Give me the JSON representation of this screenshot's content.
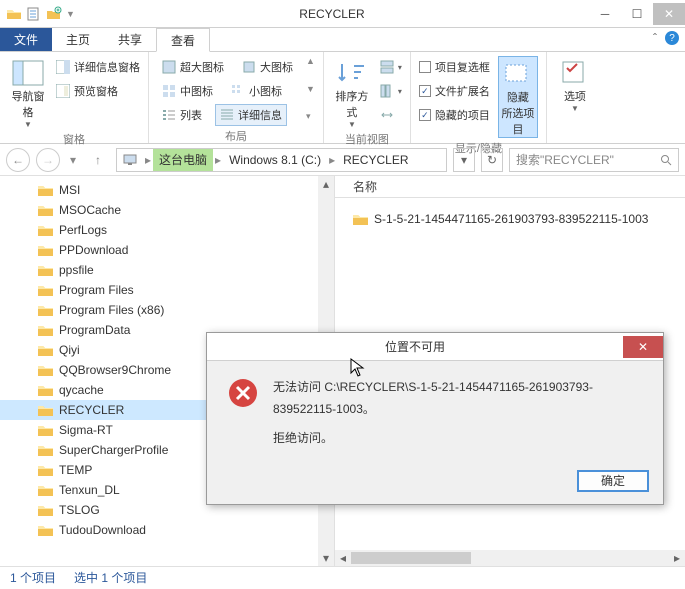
{
  "window": {
    "title": "RECYCLER"
  },
  "ribbon": {
    "tabs": {
      "file": "文件",
      "home": "主页",
      "share": "共享",
      "view": "查看"
    },
    "groups": {
      "panes": {
        "label": "窗格",
        "nav_pane": "导航窗格",
        "preview_pane": "预览窗格",
        "details_pane": "详细信息窗格"
      },
      "layout": {
        "label": "布局",
        "extra_large": "超大图标",
        "large": "大图标",
        "medium": "中图标",
        "small": "小图标",
        "list": "列表",
        "details": "详细信息"
      },
      "current_view": {
        "label": "当前视图",
        "sort": "排序方式"
      },
      "show_hide": {
        "label": "显示/隐藏",
        "item_checkboxes": "项目复选框",
        "file_ext": "文件扩展名",
        "hidden_items": "隐藏的项目",
        "hide": "隐藏",
        "selected": "所选项目"
      },
      "options": {
        "label": "选项"
      }
    }
  },
  "nav": {
    "crumb1": "这台电脑",
    "crumb2": "Windows 8.1 (C:)",
    "crumb3": "RECYCLER",
    "search_placeholder": "搜索\"RECYCLER\""
  },
  "tree": {
    "items": [
      "MSI",
      "MSOCache",
      "PerfLogs",
      "PPDownload",
      "ppsfile",
      "Program Files",
      "Program Files (x86)",
      "ProgramData",
      "Qiyi",
      "QQBrowser9Chrome",
      "qycache",
      "RECYCLER",
      "Sigma-RT",
      "SuperChargerProfile",
      "TEMP",
      "Tenxun_DL",
      "TSLOG",
      "TudouDownload"
    ],
    "selected_index": 11
  },
  "files": {
    "header_name": "名称",
    "item0": "S-1-5-21-1454471165-261903793-839522115-1003"
  },
  "status": {
    "count": "1 个项目",
    "selection": "选中 1 个项目"
  },
  "dialog": {
    "title": "位置不可用",
    "line1": "无法访问 C:\\RECYCLER\\S-1-5-21-1454471165-261903793-839522115-1003。",
    "line2": "拒绝访问。",
    "ok": "确定"
  }
}
